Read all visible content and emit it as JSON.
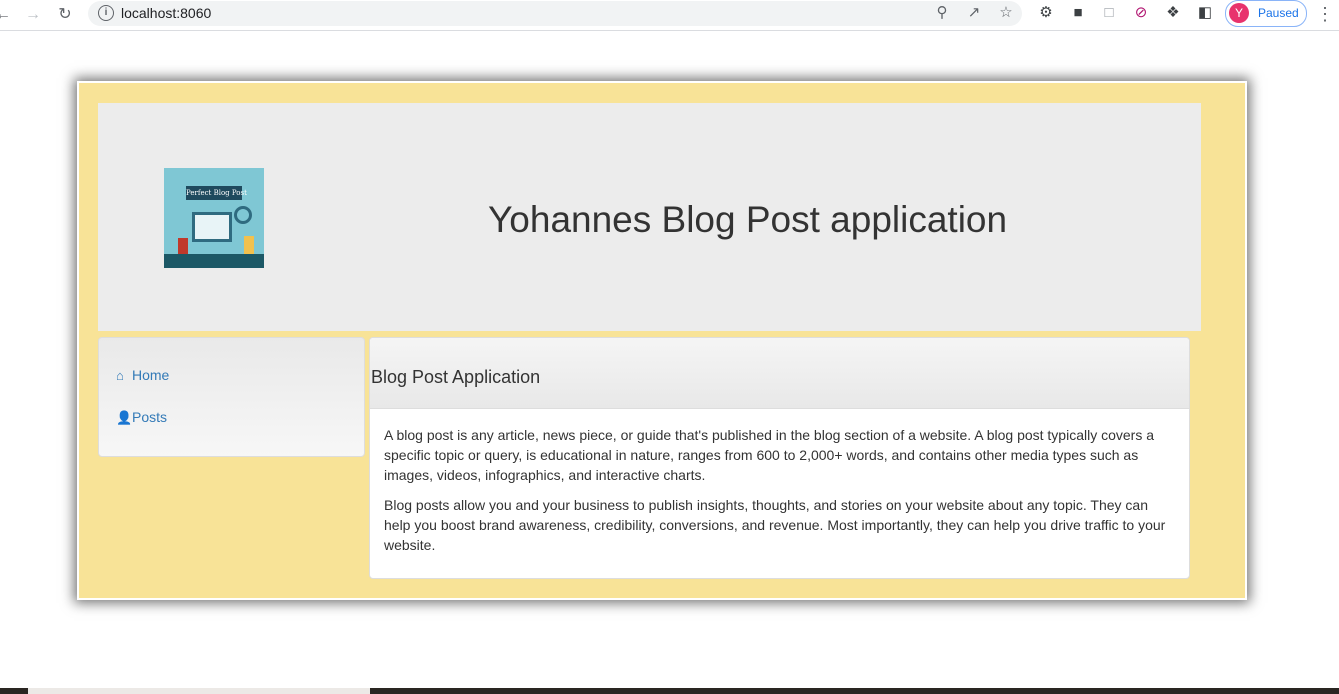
{
  "browser": {
    "url": "localhost:8060",
    "profile_initial": "Y",
    "profile_status": "Paused",
    "accent_color": "#1a73e8",
    "icons": [
      "back-arrow-icon",
      "forward-arrow-icon",
      "reload-icon",
      "info-icon",
      "zoom-icon",
      "share-icon",
      "star-icon",
      "extension-icon",
      "screen-icon",
      "capture-icon",
      "block-icon",
      "puzzle-icon",
      "sidepanel-icon",
      "menu-dots-icon"
    ]
  },
  "header": {
    "title": "Yohannes Blog Post application",
    "logo_text": "Perfect Blog Post",
    "background": "#ececec"
  },
  "sidebar": {
    "items": [
      {
        "label": "Home",
        "icon": "home-icon"
      },
      {
        "label": "Posts",
        "icon": "person-icon"
      }
    ]
  },
  "panel": {
    "title": "Blog Post Application",
    "paragraphs": [
      "A blog post is any article, news piece, or guide that's published in the blog section of a website. A blog post typically covers a specific topic or query, is educational in nature, ranges from 600 to 2,000+ words, and contains other media types such as images, videos, infographics, and interactive charts.",
      "Blog posts allow you and your business to publish insights, thoughts, and stories on your website about any topic. They can help you boost brand awareness, credibility, conversions, and revenue. Most importantly, they can help you drive traffic to your website."
    ]
  },
  "colors": {
    "page_frame": "#f8e397",
    "link": "#337ab7"
  }
}
